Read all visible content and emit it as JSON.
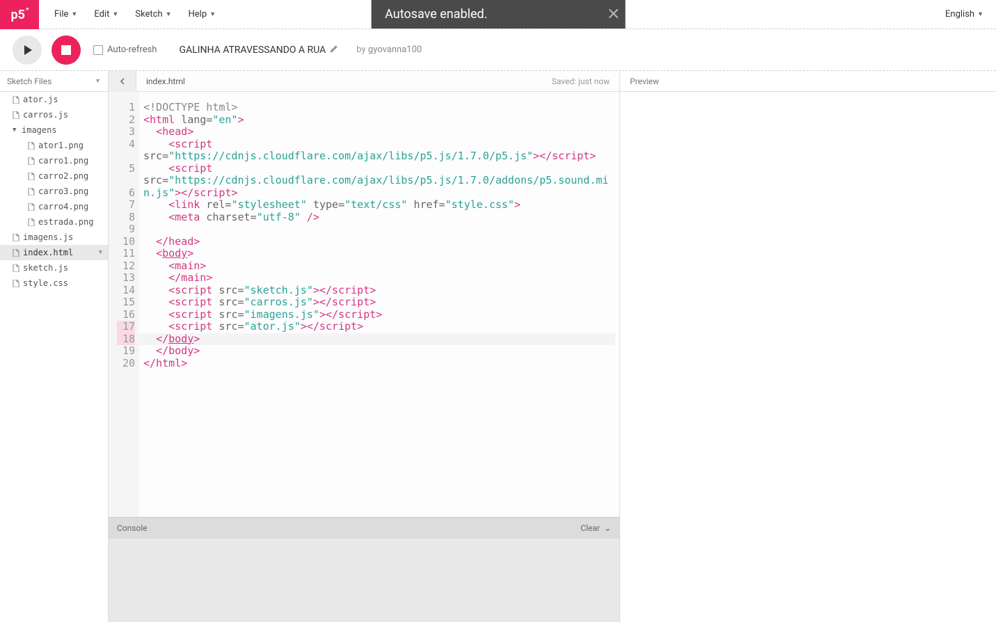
{
  "logo": "p5",
  "menu": {
    "file": "File",
    "edit": "Edit",
    "sketch": "Sketch",
    "help": "Help"
  },
  "language": "English",
  "toast": "Autosave enabled.",
  "toolbar": {
    "autorefresh": "Auto-refresh",
    "sketch_name": "GALINHA ATRAVESSANDO A RUA",
    "by": "by",
    "author": "gyovanna100"
  },
  "sidebar": {
    "header": "Sketch Files",
    "files": [
      {
        "name": "ator.js",
        "level": 1,
        "type": "file"
      },
      {
        "name": "carros.js",
        "level": 1,
        "type": "file"
      },
      {
        "name": "imagens",
        "level": 1,
        "type": "folder"
      },
      {
        "name": "ator1.png",
        "level": 2,
        "type": "file"
      },
      {
        "name": "carro1.png",
        "level": 2,
        "type": "file"
      },
      {
        "name": "carro2.png",
        "level": 2,
        "type": "file"
      },
      {
        "name": "carro3.png",
        "level": 2,
        "type": "file"
      },
      {
        "name": "carro4.png",
        "level": 2,
        "type": "file"
      },
      {
        "name": "estrada.png",
        "level": 2,
        "type": "file"
      },
      {
        "name": "imagens.js",
        "level": 1,
        "type": "file"
      },
      {
        "name": "index.html",
        "level": 1,
        "type": "file",
        "active": true
      },
      {
        "name": "sketch.js",
        "level": 1,
        "type": "file"
      },
      {
        "name": "style.css",
        "level": 1,
        "type": "file"
      }
    ]
  },
  "editor": {
    "tab": "index.html",
    "saved": "Saved: just now",
    "line_numbers": [
      "1",
      "2",
      "3",
      "4",
      "",
      "5",
      "",
      "6",
      "7",
      "8",
      "9",
      "10",
      "11",
      "12",
      "13",
      "14",
      "15",
      "16",
      "17",
      "18",
      "19",
      "20"
    ],
    "highlight_gutter": [
      17
    ],
    "code_raw": {
      "l1": "<!DOCTYPE html>",
      "l2_open": "<",
      "l2_tag": "html",
      "l2_attr": " lang=",
      "l2_str": "\"en\"",
      "l2_close": ">",
      "l3": "<head>",
      "l4_tag": "<script",
      "l4_src": "src=",
      "l4_url": "\"https://cdnjs.cloudflare.com/ajax/libs/p5.js/1.7.0/p5.js\"",
      "l4_end": "></script",
      "l5_tag": "<script",
      "l5_src": "src=",
      "l5_url": "\"https://cdnjs.cloudflare.com/ajax/libs/p5.js/1.7.0/addons/p5.sound.min.js\"",
      "l5_end": "></script",
      "l6_a": "<link",
      "l6_rel": " rel=",
      "l6_relv": "\"stylesheet\"",
      "l6_type": " type=",
      "l6_typev": "\"text/css\"",
      "l6_href": " href=",
      "l6_hrefv": "\"style.css\"",
      "l6_end": ">",
      "l7_a": "<meta",
      "l7_cs": " charset=",
      "l7_csv": "\"utf-8\"",
      "l7_end": " />",
      "l9": "</head>",
      "l10_a": "<",
      "l10_body": "body",
      "l10_c": ">",
      "l11": "<main>",
      "l12": "</main>",
      "l13_a": "<script",
      "l13_s": " src=",
      "l13_v": "\"sketch.js\"",
      "l13_e": "></script",
      "l14_a": "<script",
      "l14_s": " src=",
      "l14_v": "\"carros.js\"",
      "l14_e": "></script",
      "l15_a": "<script",
      "l15_s": " src=",
      "l15_v": "\"imagens.js\"",
      "l15_e": "></script",
      "l16_a": "<script",
      "l16_s": " src=",
      "l16_v": "\"ator.js\"",
      "l16_e": "></script",
      "l17_a": "</",
      "l17_body": "body",
      "l17_c": ">",
      "l18": "</body>",
      "l19": "</html>"
    }
  },
  "console": {
    "label": "Console",
    "clear": "Clear"
  },
  "preview": {
    "label": "Preview"
  }
}
